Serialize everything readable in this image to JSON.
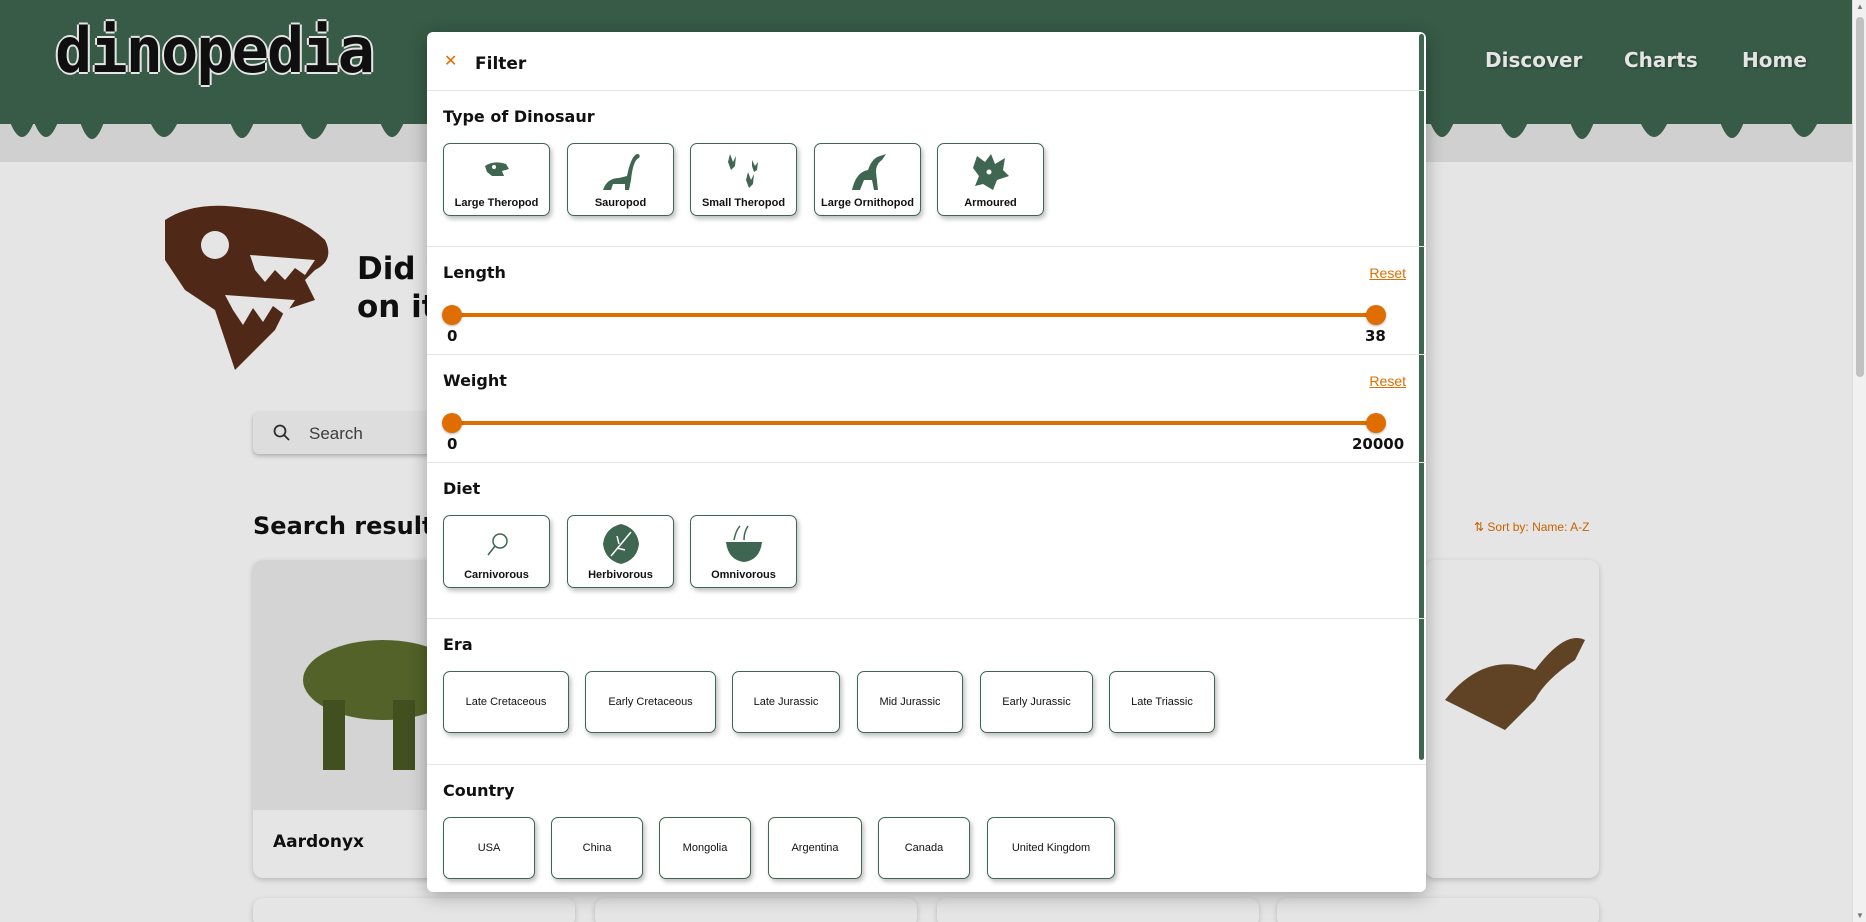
{
  "site": {
    "logo_text": "dinopedia"
  },
  "nav": {
    "discover": "Discover",
    "charts": "Charts",
    "home": "Home"
  },
  "hero": {
    "line1": "Did y",
    "line2": "on it"
  },
  "search": {
    "placeholder": "Search"
  },
  "results": {
    "title": "Search results",
    "sort_label": "Sort by: Name: A-Z",
    "first_card_name": "Aardonyx"
  },
  "filter": {
    "title": "Filter",
    "close_icon": "close-icon",
    "type_section": {
      "title": "Type of Dinosaur",
      "options": [
        "Large Theropod",
        "Sauropod",
        "Small Theropod",
        "Large Ornithopod",
        "Armoured"
      ]
    },
    "length": {
      "title": "Length",
      "reset": "Reset",
      "min": "0",
      "max": "38"
    },
    "weight": {
      "title": "Weight",
      "reset": "Reset",
      "min": "0",
      "max": "20000"
    },
    "diet": {
      "title": "Diet",
      "options": [
        "Carnivorous",
        "Herbivorous",
        "Omnivorous"
      ]
    },
    "era": {
      "title": "Era",
      "options": [
        "Late Cretaceous",
        "Early Cretaceous",
        "Late Jurassic",
        "Mid Jurassic",
        "Early Jurassic",
        "Late Triassic"
      ]
    },
    "country": {
      "title": "Country",
      "options": [
        "USA",
        "China",
        "Mongolia",
        "Argentina",
        "Canada",
        "United Kingdom"
      ]
    }
  },
  "colors": {
    "brand_green": "#3e6650",
    "accent_orange": "#e06d00",
    "skull_brown": "#5a2d1a"
  }
}
